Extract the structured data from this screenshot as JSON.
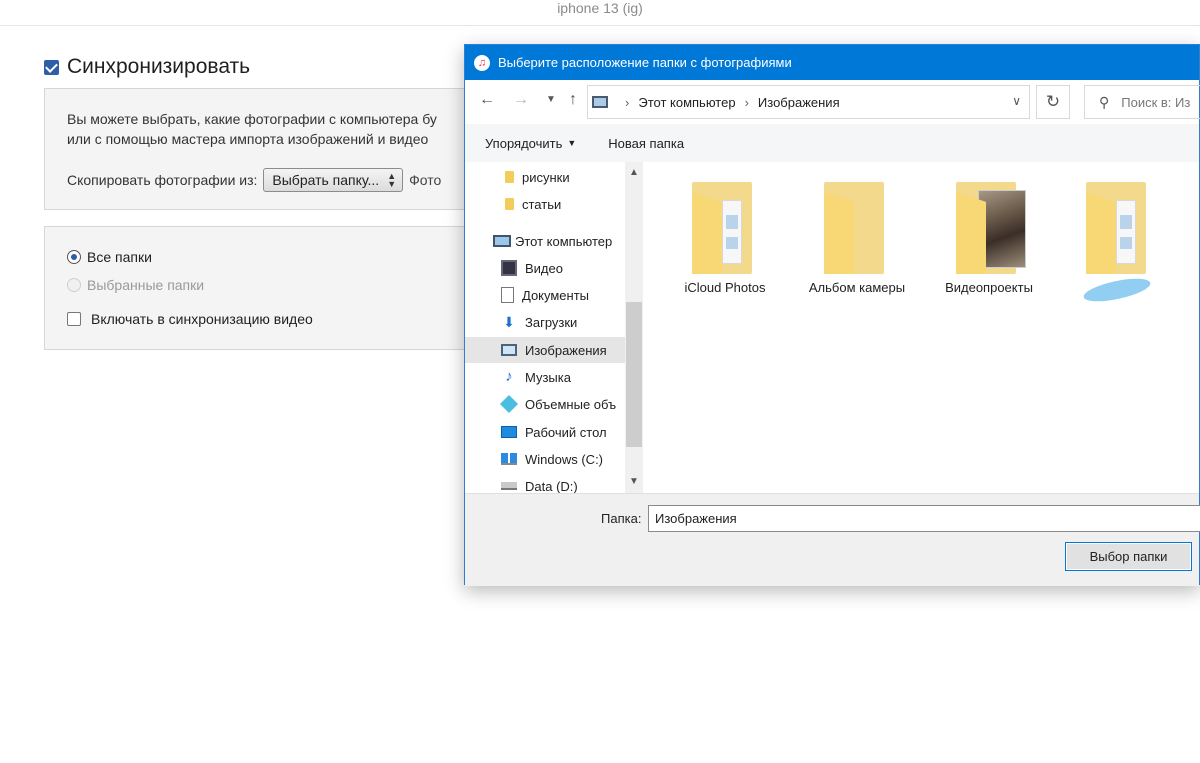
{
  "device_title": "iphone 13 (ig)",
  "sync": {
    "label": "Синхронизировать",
    "checked": true,
    "description_line1": "Вы можете выбрать, какие фотографии с компьютера бу",
    "description_line2": "или с помощью мастера импорта изображений и видео",
    "copy_from_label": "Скопировать фотографии из:",
    "copy_from_value": "Выбрать папку...",
    "copy_tail": "Фото",
    "options": {
      "all_folders": "Все папки",
      "selected_folders": "Выбранные папки",
      "include_video": "Включать в синхронизацию видео"
    }
  },
  "dialog": {
    "title": "Выберите расположение папки с фотографиями",
    "address": {
      "crumbs": [
        "Этот компьютер",
        "Изображения"
      ],
      "search_placeholder": "Поиск в: Из"
    },
    "toolbar": {
      "organize": "Упорядочить",
      "new_folder": "Новая папка"
    },
    "nav_items": [
      {
        "label": "рисунки",
        "icon": "folder-icon"
      },
      {
        "label": "статьи",
        "icon": "folder-icon"
      },
      {
        "label": "Этот компьютер",
        "icon": "computer-icon"
      },
      {
        "label": "Видео",
        "icon": "video-icon"
      },
      {
        "label": "Документы",
        "icon": "documents-icon"
      },
      {
        "label": "Загрузки",
        "icon": "downloads-icon"
      },
      {
        "label": "Изображения",
        "icon": "pictures-icon",
        "selected": true
      },
      {
        "label": "Музыка",
        "icon": "music-icon"
      },
      {
        "label": "Объемные объ",
        "icon": "3d-objects-icon"
      },
      {
        "label": "Рабочий стол",
        "icon": "desktop-icon"
      },
      {
        "label": "Windows (C:)",
        "icon": "windows-drive-icon"
      },
      {
        "label": "Data (D:)",
        "icon": "drive-icon"
      }
    ],
    "files": [
      {
        "name": "iCloud Photos",
        "kind": "documents-folder"
      },
      {
        "name": "Альбом камеры",
        "kind": "folder"
      },
      {
        "name": "Видеопроекты",
        "kind": "photo-folder"
      },
      {
        "name": "",
        "kind": "documents-folder"
      }
    ],
    "folder_label": "Папка:",
    "folder_value": "Изображения",
    "ok_button": "Выбор папки"
  },
  "colors": {
    "titlebar": "#0078d7",
    "accent": "#2f5ea8"
  }
}
